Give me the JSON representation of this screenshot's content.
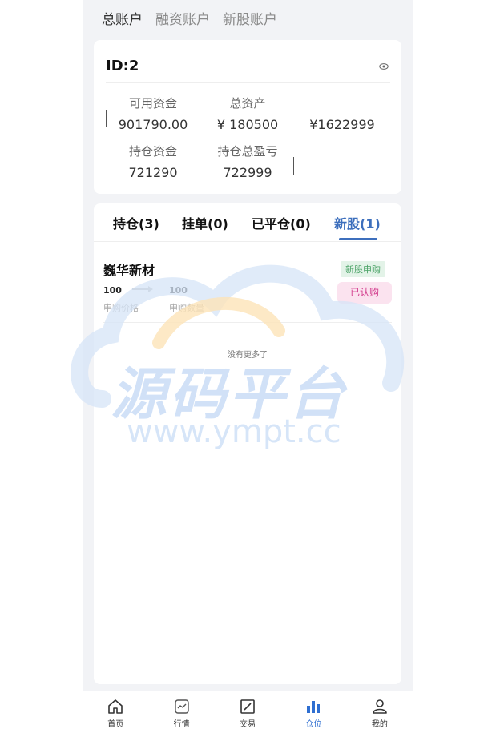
{
  "account_tabs": [
    {
      "label": "总账户",
      "active": true
    },
    {
      "label": "融资账户",
      "active": false
    },
    {
      "label": "新股账户",
      "active": false
    }
  ],
  "summary": {
    "id_label": "ID:2",
    "available_funds_label": "可用资金",
    "available_funds_value": "901790.00",
    "total_assets_label": "总资产",
    "total_assets_value": "¥ 180500",
    "extra_value": "¥1622999",
    "position_funds_label": "持仓资金",
    "position_funds_value": "721290",
    "position_pnl_label": "持仓总盈亏",
    "position_pnl_value": "722999"
  },
  "position_tabs": [
    {
      "label": "持仓(3)",
      "active": false
    },
    {
      "label": "挂单(0)",
      "active": false
    },
    {
      "label": "已平仓(0)",
      "active": false
    },
    {
      "label": "新股(1)",
      "active": true
    }
  ],
  "ipo_item": {
    "name": "巍华新材",
    "badge": "新股申购",
    "status": "已认购",
    "price_value": "100",
    "price_label": "申购价格",
    "quantity_value": "100",
    "quantity_label": "申购数量"
  },
  "no_more_text": "没有更多了",
  "watermark": {
    "title": "源码平台",
    "url": "www.ympt.cc"
  },
  "bottom_nav": [
    {
      "label": "首页",
      "icon": "home-icon",
      "active": false
    },
    {
      "label": "行情",
      "icon": "market-chart-icon",
      "active": false
    },
    {
      "label": "交易",
      "icon": "trade-icon",
      "active": false
    },
    {
      "label": "仓位",
      "icon": "bar-chart-icon",
      "active": true
    },
    {
      "label": "我的",
      "icon": "user-icon",
      "active": false
    }
  ],
  "colors": {
    "accent_blue": "#3d6fbd",
    "nav_active": "#2f6fd1",
    "badge_green": "#4aa266",
    "badge_pink": "#d23b8c",
    "page_bg": "#f2f3f6"
  }
}
